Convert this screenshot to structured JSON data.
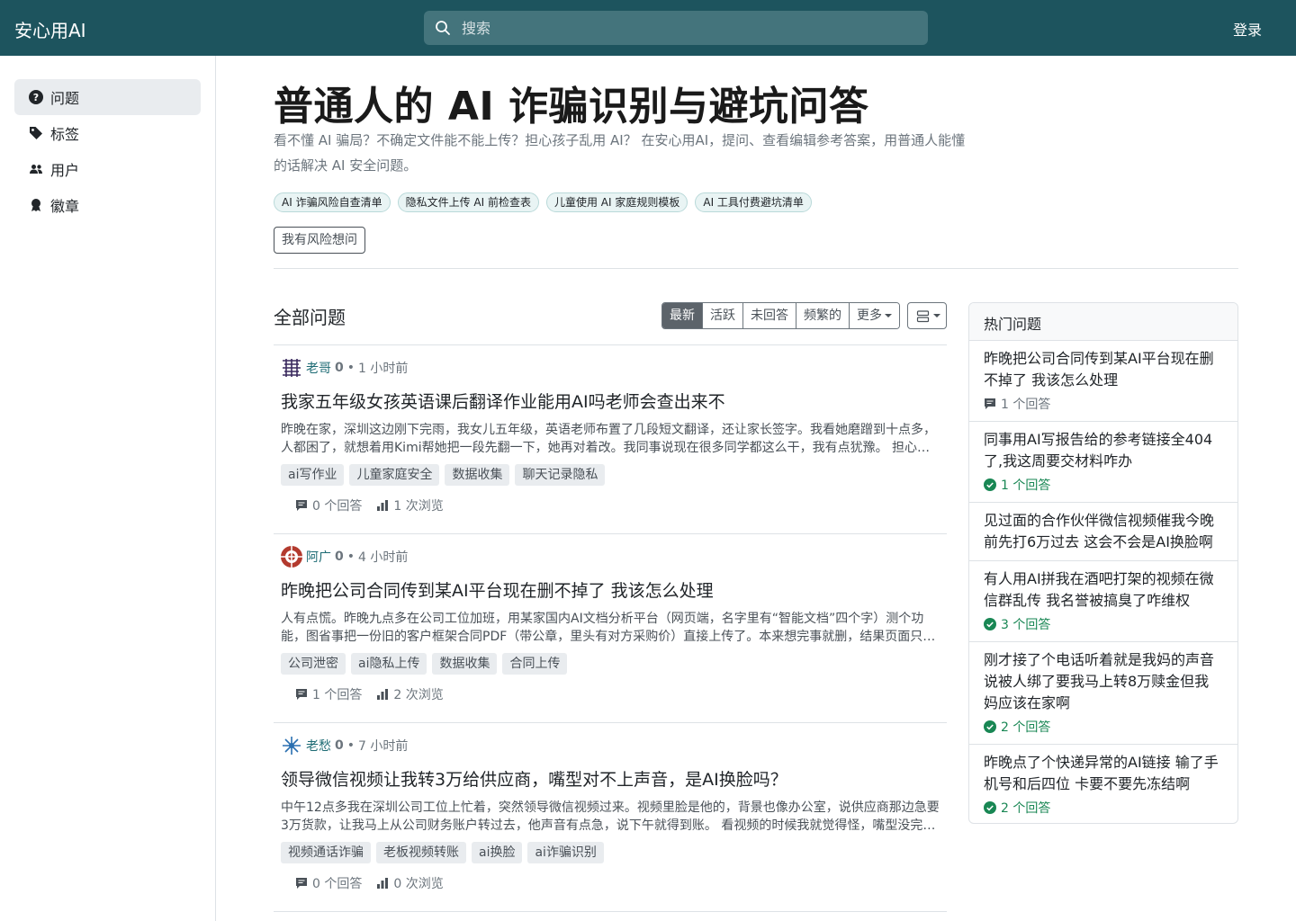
{
  "header": {
    "brand": "安心用AI",
    "search_placeholder": "搜索",
    "login": "登录"
  },
  "sidebar": {
    "items": [
      {
        "label": "问题",
        "icon": "question-circle-icon"
      },
      {
        "label": "标签",
        "icon": "tag-icon"
      },
      {
        "label": "用户",
        "icon": "people-icon"
      },
      {
        "label": "徽章",
        "icon": "award-icon"
      }
    ]
  },
  "hero": {
    "title": "普通人的 AI 诈骗识别与避坑问答",
    "description": "看不懂 AI 骗局？不确定文件能不能上传？担心孩子乱用 AI？ 在安心用AI，提问、查看编辑参考答案，用普通人能懂的话解决 AI 安全问题。",
    "pills": [
      "AI 诈骗风险自查清单",
      "隐私文件上传 AI 前检查表",
      "儿童使用 AI 家庭规则模板",
      "AI 工具付费避坑清单"
    ],
    "ask_button": "我有风险想问"
  },
  "list": {
    "title": "全部问题",
    "tabs": [
      "最新",
      "活跃",
      "未回答",
      "频繁的",
      "更多"
    ]
  },
  "questions": [
    {
      "user": "老哥",
      "rep": "0",
      "time": "1 小时前",
      "title": "我家五年级女孩英语课后翻译作业能用AI吗老师会查出来不",
      "excerpt": "昨晚在家，深圳这边刚下完雨，我女儿五年级，英语老师布置了几段短文翻译，还让家长签字。我看她磨蹭到十点多，人都困了，就想着用Kimi帮她把一段先翻一下，她再对着改。我同事说现在很多同学都这么干，我有点犹豫。 担心老师会不会查出来。",
      "tags": [
        "ai写作业",
        "儿童家庭安全",
        "数据收集",
        "聊天记录隐私"
      ],
      "answers": "0 个回答",
      "views": "1 次浏览"
    },
    {
      "user": "阿广",
      "rep": "0",
      "time": "4 小时前",
      "title": "昨晚把公司合同传到某AI平台现在删不掉了 我该怎么处理",
      "excerpt": "人有点慌。昨晚九点多在公司工位加班，用某家国内AI文档分析平台（网页端，名字里有“智能文档”四个字）测个功能，图省事把一份旧的客户框架合同PDF（带公章，里头有对方采购价）直接上传了。本来想完事就删，结果页面只能清空对话。",
      "tags": [
        "公司泄密",
        "ai隐私上传",
        "数据收集",
        "合同上传"
      ],
      "answers": "1 个回答",
      "views": "2 次浏览"
    },
    {
      "user": "老愁",
      "rep": "0",
      "time": "7 小时前",
      "title": "领导微信视频让我转3万给供应商，嘴型对不上声音，是AI换脸吗？",
      "excerpt": "中午12点多我在深圳公司工位上忙着，突然领导微信视频过来。视频里脸是他的，背景也像办公室，说供应商那边急要3万货款，让我马上从公司财务账户转过去，他声音有点急，说下午就得到账。 看视频的时候我就觉得怪，嘴型没完全对上。",
      "tags": [
        "视频通话诈骗",
        "老板视频转账",
        "ai换脸",
        "ai诈骗识别"
      ],
      "answers": "0 个回答",
      "views": "0 次浏览"
    }
  ],
  "hot": {
    "title": "热门问题",
    "items": [
      {
        "title": "昨晚把公司合同传到某AI平台现在删不掉了 我该怎么处理",
        "answers": "1 个回答",
        "answered": false
      },
      {
        "title": "同事用AI写报告给的参考链接全404了,我这周要交材料咋办",
        "answers": "1 个回答",
        "answered": true
      },
      {
        "title": "见过面的合作伙伴微信视频催我今晚前先打6万过去 这会不会是AI换脸啊",
        "answers": "",
        "answered": false
      },
      {
        "title": "有人用AI拼我在酒吧打架的视频在微信群乱传 我名誉被搞臭了咋维权",
        "answers": "3 个回答",
        "answered": true
      },
      {
        "title": "刚才接了个电话听着就是我妈的声音说被人绑了要我马上转8万赎金但我妈应该在家啊",
        "answers": "2 个回答",
        "answered": true
      },
      {
        "title": "昨晚点了个快递异常的AI链接 输了手机号和后四位 卡要不要先冻结啊",
        "answers": "2 个回答",
        "answered": true
      }
    ]
  },
  "colors": {
    "header_bg": "#1d545e",
    "link": "#1d6b74",
    "success": "#198754"
  }
}
